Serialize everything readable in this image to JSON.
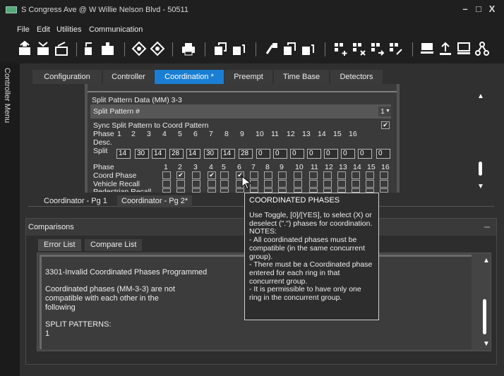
{
  "window": {
    "title": "S Congress Ave @ W Willie Nelson Blvd - 50511",
    "minimize": "–",
    "maximize": "□",
    "close": "X"
  },
  "menu": {
    "file": "File",
    "edit": "Edit",
    "utilities": "Utilities",
    "communication": "Communication"
  },
  "sidebar": {
    "label": "Controller Menu"
  },
  "tabs": [
    "Configuration",
    "Controller",
    "Coordination *",
    "Preempt",
    "Time Base",
    "Detectors"
  ],
  "coord": {
    "section_title": "Split Pattern Data (MM) 3-3",
    "split_pattern_label": "Split Pattern #",
    "split_pattern_value": "1",
    "sync_label": "Sync Split Pattern to Coord Pattern",
    "sync_checked": "✔",
    "phase_label": "Phase",
    "desc_label": "Desc.",
    "split_label": "Split",
    "phases": [
      "1",
      "2",
      "3",
      "4",
      "5",
      "6",
      "7",
      "8",
      "9",
      "10",
      "11",
      "12",
      "13",
      "14",
      "15",
      "16"
    ],
    "splits": [
      "14",
      "30",
      "14",
      "28",
      "14",
      "30",
      "14",
      "28",
      "0",
      "0",
      "0",
      "0",
      "0",
      "0",
      "0",
      "0"
    ],
    "coord_phase_label": "Coord Phase",
    "vehicle_recall_label": "Vehicle Recall",
    "ped_recall_label": "Pedestrian Recall",
    "coord_phase_checks": [
      "",
      "✔",
      "",
      "✔",
      "",
      "✔",
      "",
      "",
      "",
      "",
      "",
      "",
      "",
      "",
      "",
      ""
    ]
  },
  "subtabs": [
    "Coordinator - Pg 1",
    "Coordinator - Pg 2*"
  ],
  "comparisons": {
    "title": "Comparisons",
    "tabs": [
      "Error List",
      "Compare List"
    ],
    "errors": {
      "line1": "3301-Invalid Coordinated Phases Programmed",
      "line2": "Coordinated phases (MM-3-3) are not\ncompatible with each other in the\nfollowing",
      "line3": "SPLIT PATTERNS:\n1"
    }
  },
  "tooltip": {
    "title": "COORDINATED PHASES",
    "body": "Use Toggle, [0]/[YES], to select (X) or\ndeselect (\".\") phases for coordination.\nNOTES:\n- All coordinated phases must be\ncompatible (in the same concurrent\ngroup).\n- There must be a Coordinated phase\nentered for each ring in that\nconcurrent group.\n- It is permissible to have only one\nring in the concurrent group."
  },
  "icons": {
    "scroll_up": "▲",
    "scroll_down": "▼"
  },
  "colors": {
    "accent": "#1a7fd4"
  }
}
